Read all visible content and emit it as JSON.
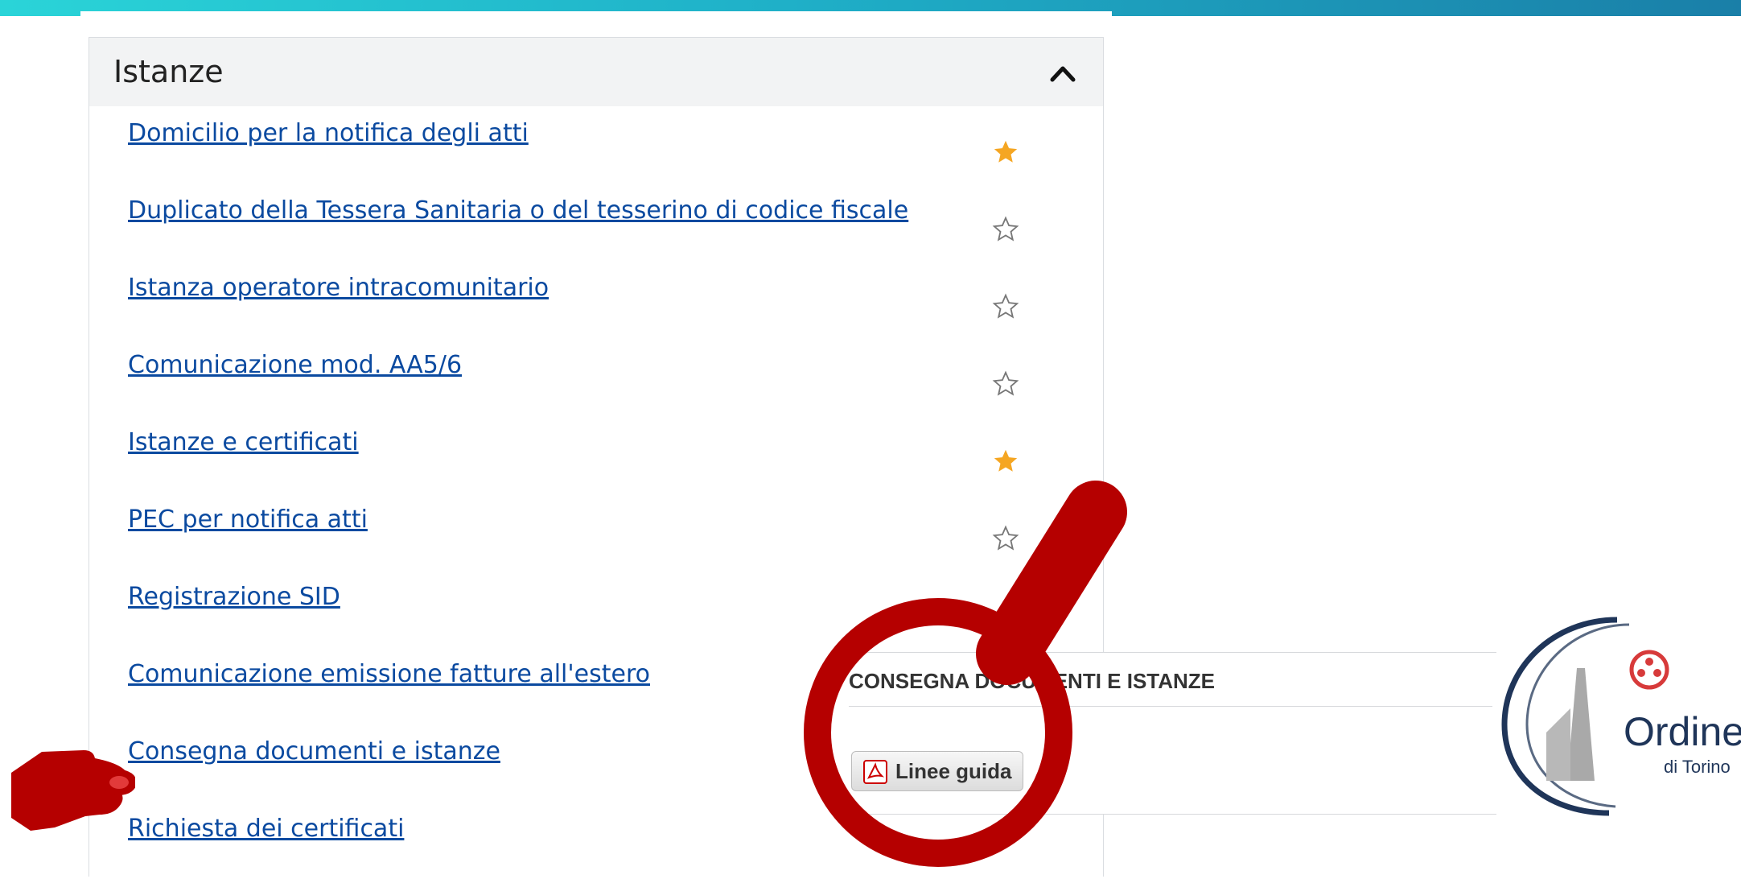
{
  "panel": {
    "title": "Istanze",
    "collapse_icon": "chevron-up-icon",
    "items": [
      {
        "label": "Domicilio per la notifica degli atti",
        "favorite": true
      },
      {
        "label": "Duplicato della Tessera Sanitaria o del tesserino di codice fiscale",
        "favorite": false
      },
      {
        "label": "Istanza operatore intracomunitario",
        "favorite": false
      },
      {
        "label": "Comunicazione mod. AA5/6",
        "favorite": false
      },
      {
        "label": "Istanze e certificati",
        "favorite": true
      },
      {
        "label": "PEC per notifica atti",
        "favorite": false
      },
      {
        "label": "Registrazione SID",
        "favorite": false
      },
      {
        "label": "Comunicazione emissione fatture all'estero",
        "favorite": false
      },
      {
        "label": "Consegna documenti e istanze",
        "favorite": false
      },
      {
        "label": "Richiesta dei certificati",
        "favorite": false
      }
    ]
  },
  "popup": {
    "title": "CONSEGNA DOCUMENTI E ISTANZE",
    "button_label": "Linee guida",
    "button_icon": "pdf-icon"
  },
  "logo": {
    "main": "Ordine",
    "sub": "di Torino"
  },
  "colors": {
    "link": "#0b4aa0",
    "star_active": "#f5a623",
    "overlay_red": "#b50000",
    "header_gradient_start": "#2ad4d8",
    "header_gradient_end": "#1a7fa8"
  }
}
